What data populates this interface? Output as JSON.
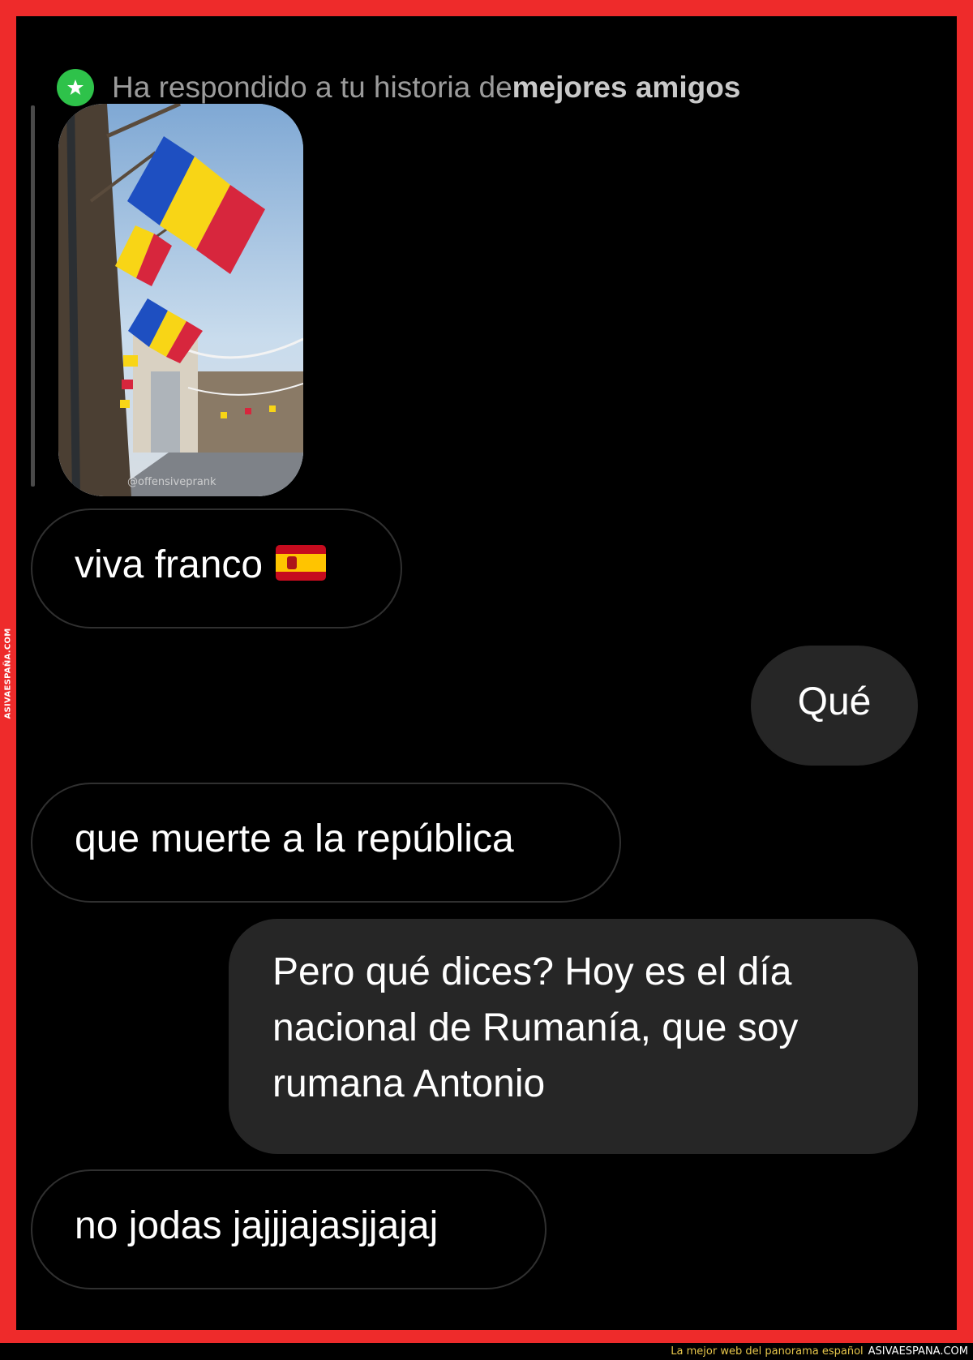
{
  "reply_header": {
    "prefix": "Ha respondido a tu historia de ",
    "bold": "mejores amigos",
    "badge_icon": "star-icon",
    "badge_color": "#2ec24a"
  },
  "story": {
    "watermark": "@offensiveprank"
  },
  "messages": [
    {
      "side": "in",
      "text": "viva franco",
      "emoji": "spain-flag"
    },
    {
      "side": "out",
      "text": "Qué"
    },
    {
      "side": "in",
      "text": "que muerte a la república"
    },
    {
      "side": "out",
      "lines": [
        "Pero qué dices? Hoy es el día",
        "nacional de Rumanía, que soy",
        "rumana Antonio"
      ]
    },
    {
      "side": "in",
      "text": "no jodas jajjjajasjjajaj"
    }
  ],
  "branding": {
    "side_watermark": "ASIVAESPAÑA.COM",
    "tagline": "La mejor web del panorama español",
    "site": "ASIVAESPANA.COM",
    "frame_color": "#ee2b2b"
  }
}
